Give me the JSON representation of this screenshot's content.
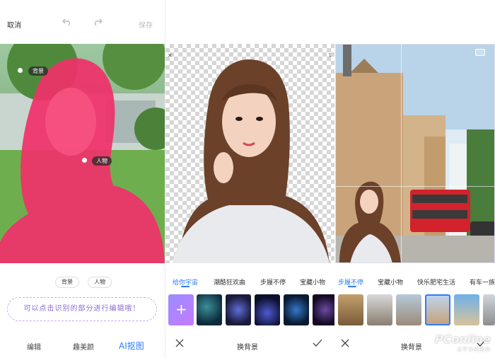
{
  "editor": {
    "cancel_label": "取消",
    "save_label": "保存",
    "tag_background": "背景",
    "tag_person": "人物",
    "chip_background": "背景",
    "chip_person": "人物",
    "hint_text": "可以点击识别的部分进行编辑哦！",
    "bottom_tabs": [
      "编辑",
      "趣美颜",
      "AI抠图"
    ]
  },
  "background_picker_1": {
    "categories": [
      "给你宇宙",
      "潮酷狂欢曲",
      "步履不停",
      "宝藏小物"
    ],
    "selected_category": "给你宇宙",
    "title": "换背景"
  },
  "background_picker_2": {
    "categories": [
      "步履不停",
      "宝藏小物",
      "快乐肥宅生活",
      "有车一族"
    ],
    "selected_category": "步履不停",
    "title": "换背景"
  },
  "watermark": {
    "brand": "PConline",
    "sub": "太平洋电脑网"
  },
  "colors": {
    "accent": "#2f7cf6",
    "person_mask": "#f0306a",
    "hint_purple": "#8e6bd1"
  }
}
